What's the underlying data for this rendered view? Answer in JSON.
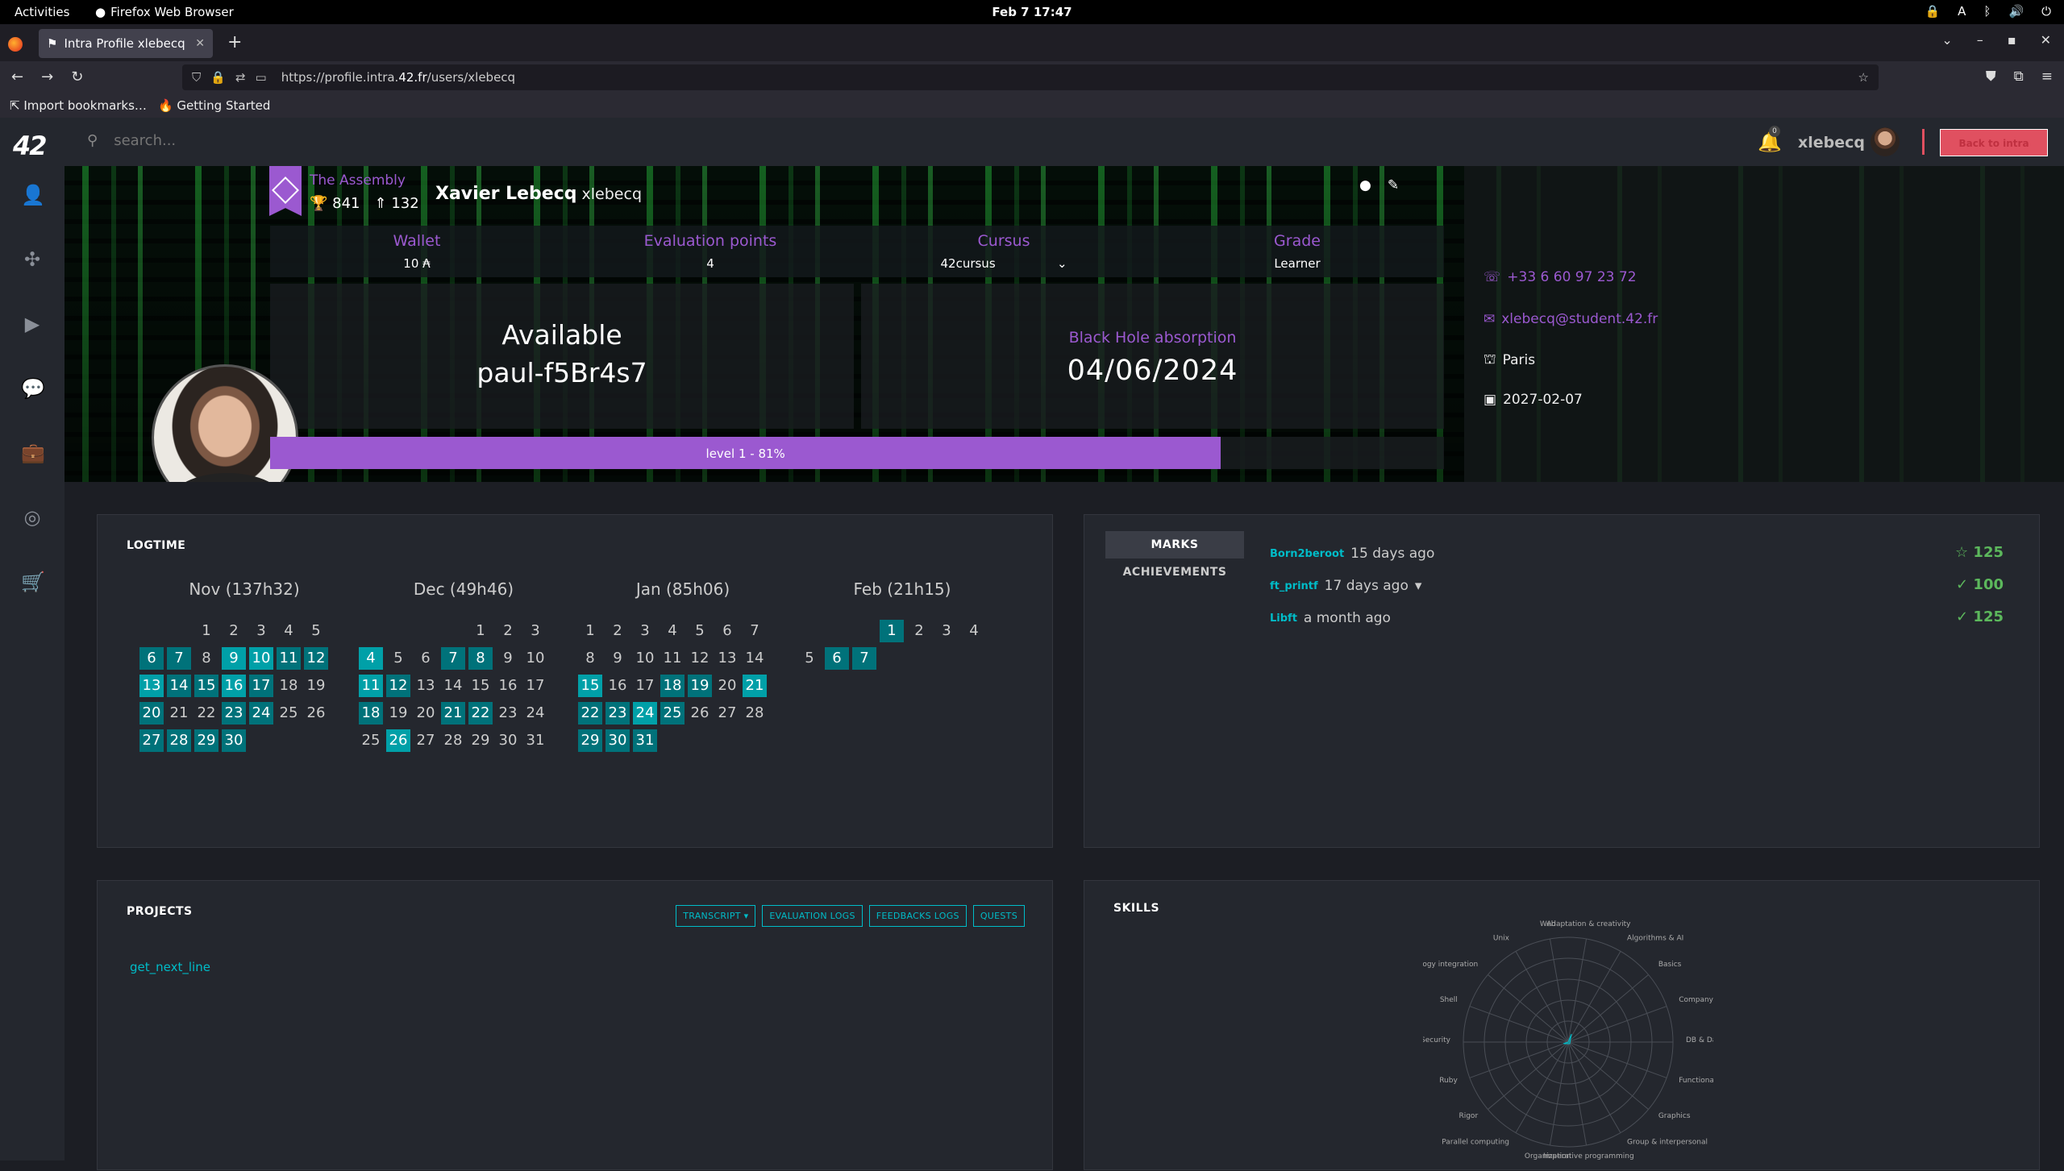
{
  "system": {
    "activities": "Activities",
    "app_name": "Firefox Web Browser",
    "clock": "Feb 7  17:47",
    "tray_a": "A"
  },
  "browser": {
    "tab_title": "Intra Profile xlebecq",
    "url_prefix": "https://profile.intra.",
    "url_domain": "42.fr",
    "url_path": "/users/xlebecq",
    "bookmarks": [
      "Import bookmarks…",
      "Getting Started"
    ]
  },
  "header": {
    "logo": "42",
    "search_placeholder": "search...",
    "notifications": "0",
    "username": "xlebecq",
    "logout_label": "Back to intra"
  },
  "profile": {
    "coalition": "The Assembly",
    "coalition_score": "841",
    "coalition_rank": "132",
    "full_name": "Xavier Lebecq",
    "login": "xlebecq",
    "wallet_label": "Wallet",
    "wallet_value": "10 ₳",
    "eval_label": "Evaluation points",
    "eval_value": "4",
    "cursus_label": "Cursus",
    "cursus_value": "42cursus",
    "grade_label": "Grade",
    "grade_value": "Learner",
    "availability": "Available",
    "location": "paul-f5Br4s7",
    "bh_label": "Black Hole absorption",
    "bh_date": "04/06/2024",
    "level_text": "level 1 - 81%",
    "level_percent": 81,
    "phone": "+33 6 60 97 23 72",
    "email": "xlebecq@student.42.fr",
    "city": "Paris",
    "end_date": "2027-02-07"
  },
  "logtime": {
    "title": "LOGTIME",
    "months": [
      {
        "name": "Nov (137h32)",
        "offset": 2,
        "days": 30,
        "active": [
          6,
          7,
          9,
          10,
          11,
          12,
          13,
          14,
          15,
          16,
          17,
          20,
          23,
          24,
          27,
          28,
          29,
          30
        ],
        "strong": [
          9,
          10,
          13,
          16
        ]
      },
      {
        "name": "Dec (49h46)",
        "offset": 4,
        "days": 31,
        "active": [
          4,
          7,
          8,
          11,
          12,
          18,
          21,
          22,
          26
        ],
        "strong": [
          4,
          11,
          26
        ]
      },
      {
        "name": "Jan (85h06)",
        "offset": 0,
        "days": 31,
        "active": [
          15,
          18,
          19,
          21,
          22,
          23,
          24,
          25,
          29,
          30,
          31
        ],
        "strong": [
          15,
          21,
          24
        ]
      },
      {
        "name": "Feb (21h15)",
        "offset": 3,
        "days": 7,
        "active": [
          1,
          6,
          7
        ],
        "strong": []
      }
    ]
  },
  "marks": {
    "tabs": [
      "MARKS",
      "ACHIEVEMENTS"
    ],
    "items": [
      {
        "name": "Born2beroot",
        "when": "15 days ago",
        "score": "125",
        "icon": "star"
      },
      {
        "name": "ft_printf",
        "when": "17 days ago",
        "score": "100",
        "icon": "check"
      },
      {
        "name": "Libft",
        "when": "a month ago",
        "score": "125",
        "icon": "check"
      }
    ]
  },
  "projects": {
    "title": "PROJECTS",
    "buttons": [
      "TRANSCRIPT ▾",
      "EVALUATION LOGS",
      "FEEDBACKS LOGS",
      "QUESTS"
    ],
    "items": [
      "get_next_line"
    ]
  },
  "skills": {
    "title": "SKILLS",
    "labels": [
      "Adaptation & creativity",
      "Algorithms & AI",
      "Basics",
      "Company experience",
      "DB & Data",
      "Functional programming",
      "Graphics",
      "Group & interpersonal",
      "Imperative programming",
      "Organization",
      "Parallel computing",
      "Rigor",
      "Ruby",
      "Security",
      "Shell",
      "Technology integration",
      "Unix",
      "Web"
    ]
  }
}
